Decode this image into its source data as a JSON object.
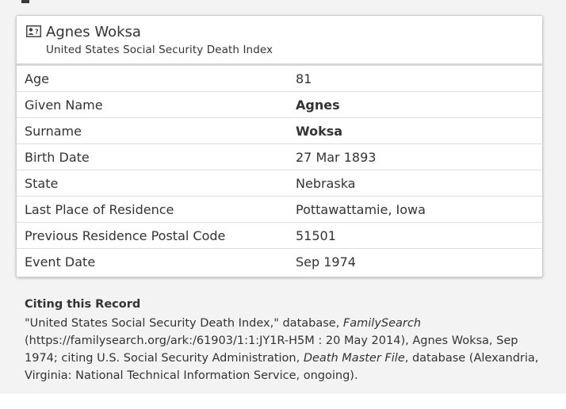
{
  "record": {
    "name": "Agnes Woksa",
    "collection": "United States Social Security Death Index"
  },
  "fields": [
    {
      "label": "Age",
      "value": "81",
      "bold": false
    },
    {
      "label": "Given Name",
      "value": "Agnes",
      "bold": true
    },
    {
      "label": "Surname",
      "value": "Woksa",
      "bold": true
    },
    {
      "label": "Birth Date",
      "value": "27 Mar 1893",
      "bold": false
    },
    {
      "label": "State",
      "value": "Nebraska",
      "bold": false
    },
    {
      "label": "Last Place of Residence",
      "value": "Pottawattamie, Iowa",
      "bold": false
    },
    {
      "label": "Previous Residence Postal Code",
      "value": "51501",
      "bold": false
    },
    {
      "label": "Event Date",
      "value": "Sep 1974",
      "bold": false
    }
  ],
  "citation": {
    "title": "Citing this Record",
    "part1": "\"United States Social Security Death Index,\" database, ",
    "italic1": "FamilySearch",
    "part2": " (https://familysearch.org/ark:/61903/1:1:JY1R-H5M : 20 May 2014), Agnes Woksa, Sep 1974; citing U.S. Social Security Administration, ",
    "italic2": "Death Master File",
    "part3": ", database (Alexandria, Virginia: National Technical Information Service, ongoing)."
  }
}
